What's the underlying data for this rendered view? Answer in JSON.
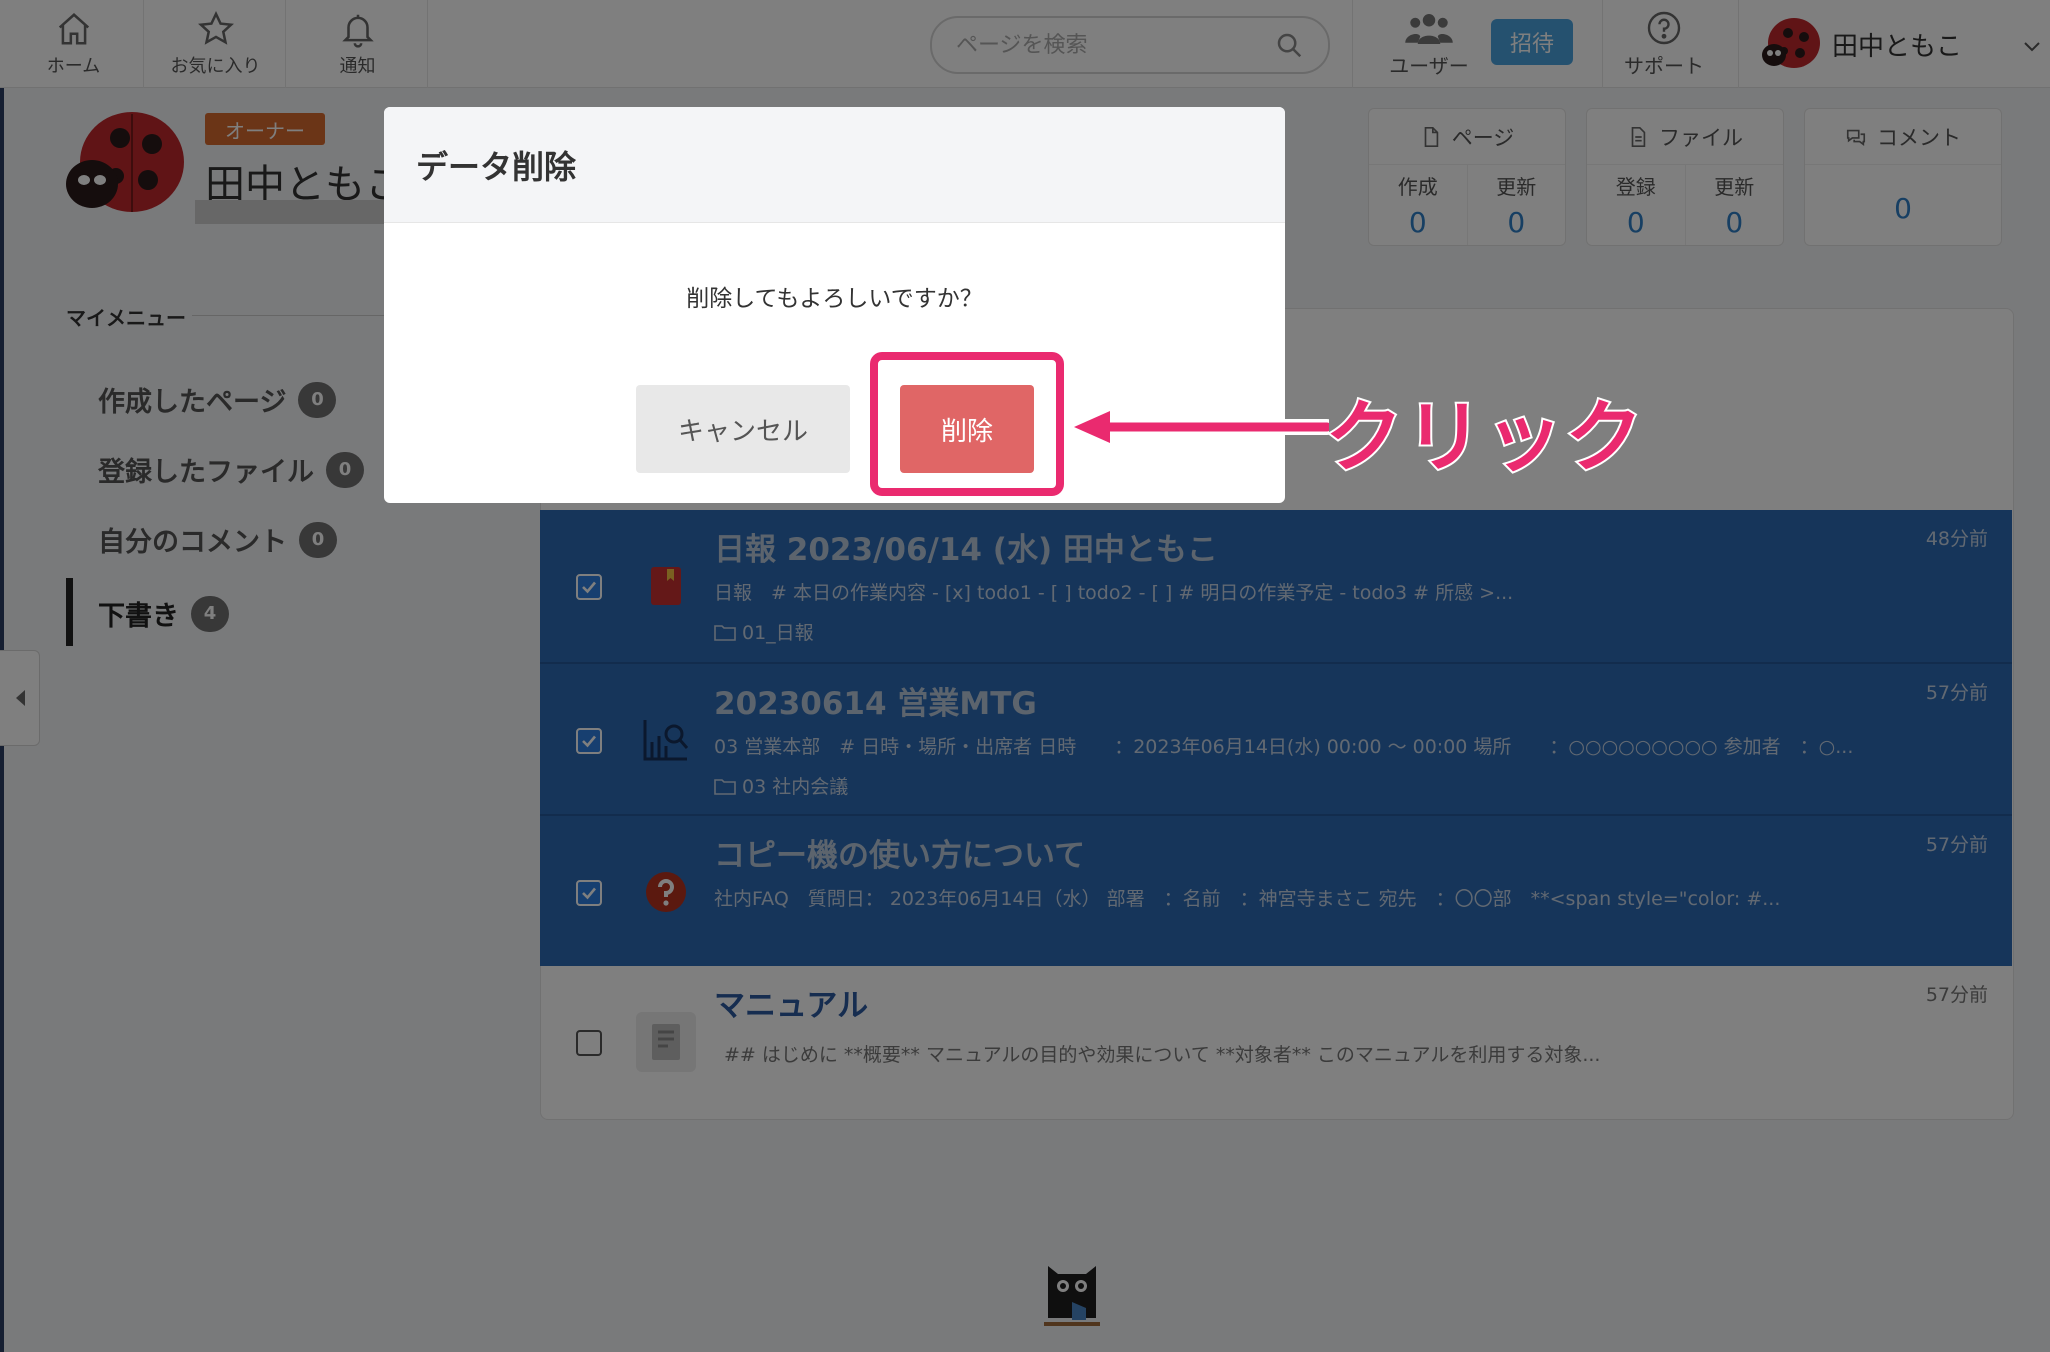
{
  "nav": {
    "home": "ホーム",
    "favorites": "お気に入り",
    "notifications": "通知"
  },
  "search": {
    "placeholder": "ページを検索"
  },
  "header_right": {
    "users": "ユーザー",
    "invite": "招待",
    "support": "サポート",
    "user_name": "田中ともこ"
  },
  "profile": {
    "badge": "オーナー",
    "name": "田中ともこ"
  },
  "stats": {
    "pages": {
      "label": "ページ",
      "created_label": "作成",
      "created": "0",
      "updated_label": "更新",
      "updated": "0"
    },
    "files": {
      "label": "ファイル",
      "registered_label": "登録",
      "registered": "0",
      "updated_label": "更新",
      "updated": "0"
    },
    "comments": {
      "label": "コメント",
      "count": "0"
    }
  },
  "mymenu": {
    "title": "マイメニュー",
    "items": [
      {
        "label": "作成したページ",
        "count": "0"
      },
      {
        "label": "登録したファイル",
        "count": "0"
      },
      {
        "label": "自分のコメント",
        "count": "0"
      },
      {
        "label": "下書き",
        "count": "4"
      }
    ]
  },
  "drafts": [
    {
      "title": "日報 2023/06/14 (水) 田中ともこ",
      "desc": "日報　# 本日の作業内容 - [x] todo1 - [ ] todo2 - [ ] # 明日の作業予定 - todo3 # 所感 >...",
      "folder": "01_日報",
      "time": "48分前",
      "checked": true,
      "icon": "bookmark-icon"
    },
    {
      "title": "20230614 営業MTG",
      "desc": "03 営業本部　# 日時・場所・出席者 日時　　：2023年06月14日(水) 00:00 〜 00:00 場所　　：○○○○○○○○○ 参加者　：○...",
      "folder": "03 社内会議",
      "time": "57分前",
      "checked": true,
      "icon": "chart-search-icon"
    },
    {
      "title": "コピー機の使い方について",
      "desc": "社内FAQ　質問日： 2023年06月14日（水） 部署　：名前　：神宮寺まさこ 宛先　：〇〇部　**<span style=\"color: #...",
      "folder": "",
      "time": "57分前",
      "checked": true,
      "icon": "question-icon"
    },
    {
      "title": "マニュアル",
      "desc": "## はじめに **概要** マニュアルの目的や効果について **対象者** このマニュアルを利用する対象...",
      "folder": "",
      "time": "57分前",
      "checked": false,
      "icon": "manual-icon"
    }
  ],
  "modal": {
    "title": "データ削除",
    "message": "削除してもよろしいですか？",
    "cancel": "キャンセル",
    "delete": "削除"
  },
  "annotation": {
    "label": "クリック",
    "color": "#ea2a6f"
  },
  "colors": {
    "selected_row": "#2d6bb4",
    "invite": "#4aa3df",
    "owner_badge": "#d76a2f",
    "delete_button": "#e06666"
  }
}
